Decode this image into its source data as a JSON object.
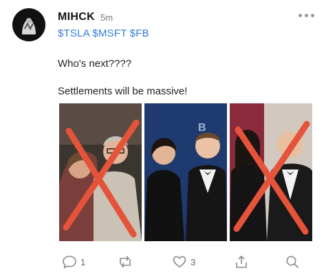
{
  "post": {
    "username": "MIHCK",
    "time": "5m",
    "tickers": "$TSLA $MSFT $FB",
    "body_line1": "Who's next????",
    "body_line2": "Settlements will be massive!"
  },
  "icons": {
    "more": "more-icon",
    "reply": "reply-icon",
    "reshare": "reshare-icon",
    "like": "like-icon",
    "share": "share-icon",
    "search": "search-icon"
  },
  "actions": {
    "reply_count": "1",
    "like_count": "3"
  },
  "colors": {
    "ticker": "#2f7bd8",
    "cross": "#e5533a",
    "icon": "#8a8a8a"
  }
}
